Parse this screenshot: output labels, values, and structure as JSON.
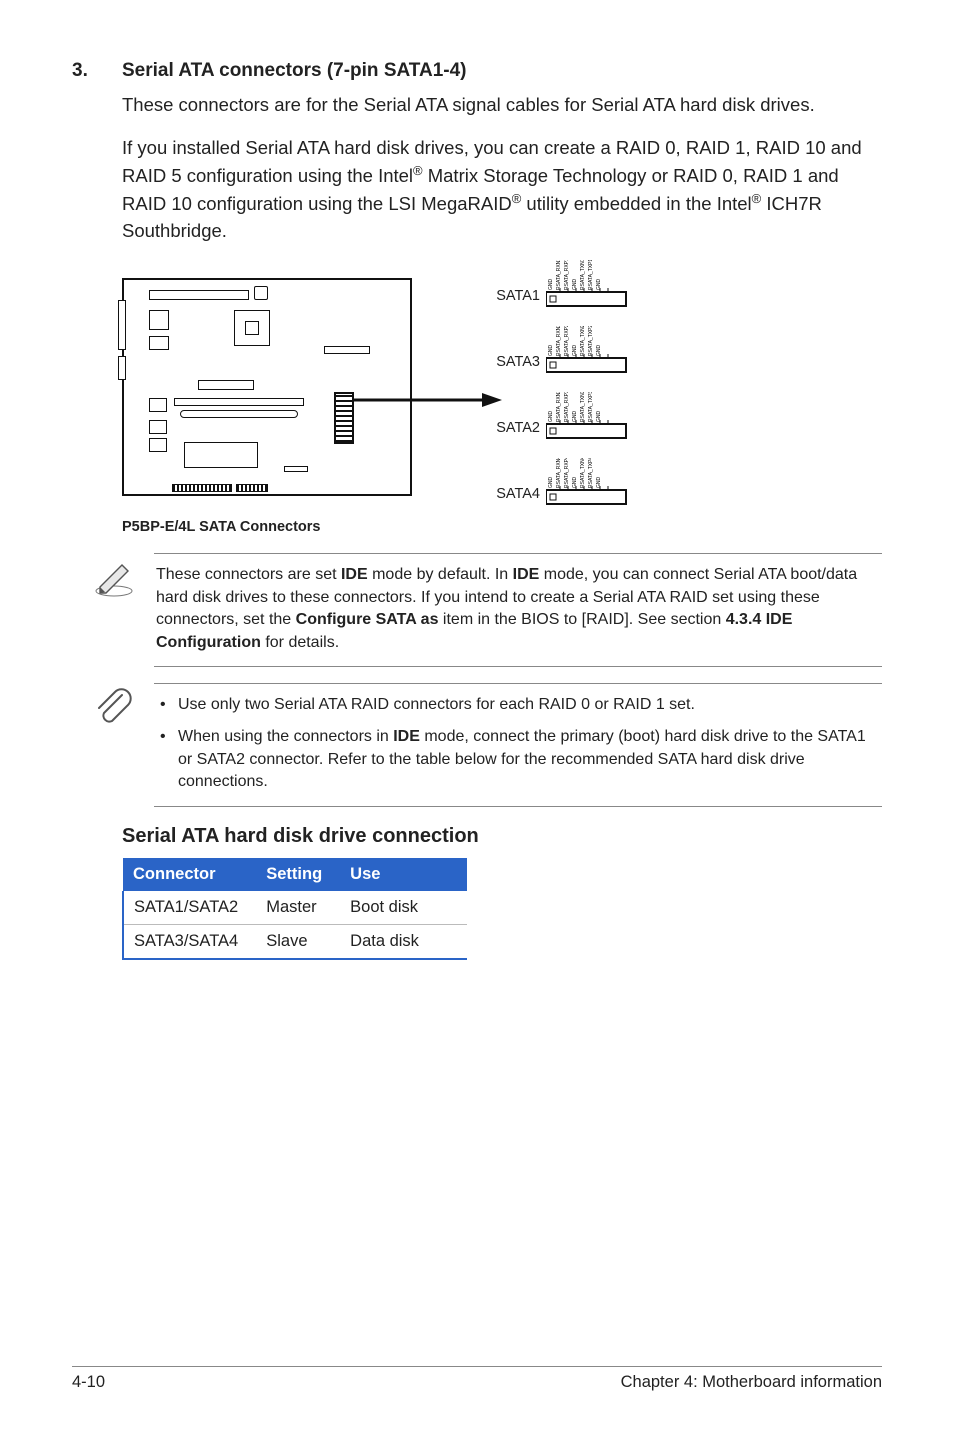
{
  "section": {
    "num": "3.",
    "title": "Serial ATA connectors (7-pin SATA1-4)"
  },
  "paras": {
    "p1": "These connectors are for the Serial ATA signal cables for Serial ATA hard disk drives.",
    "p2a": "If you installed Serial ATA hard disk drives, you can create a RAID 0, RAID 1, RAID 10 and RAID 5 configuration using the Intel",
    "p2b": " Matrix Storage Technology or RAID 0, RAID 1 and RAID 10 configuration using the LSI MegaRAID",
    "p2c": " utility embedded in the Intel",
    "p2d": " ICH7R Southbridge."
  },
  "diagram": {
    "caption": "P5BP-E/4L SATA Connectors",
    "conns": [
      "SATA1",
      "SATA3",
      "SATA2",
      "SATA4"
    ],
    "pins_a": [
      "GND",
      "RSATA_RXN1",
      "RSATA_RXP1",
      "GND",
      "RSATA_TXN1",
      "RSATA_TXP1",
      "GND"
    ],
    "pins_b": [
      "GND",
      "RSATA_RXN2",
      "RSATA_RXP2",
      "GND",
      "RSATA_TXN2",
      "RSATA_TXP2",
      "GND"
    ],
    "pins_c": [
      "GND",
      "RSATA_RXN3",
      "RSATA_RXP3",
      "GND",
      "RSATA_TXN3",
      "RSATA_TXP3",
      "GND"
    ],
    "pins_d": [
      "GND",
      "RSATA_RXN4",
      "RSATA_RXP4",
      "GND",
      "RSATA_TXN4",
      "RSATA_TXP4",
      "GND"
    ]
  },
  "pencil_note": {
    "t1": "These connectors are set ",
    "b1": "IDE",
    "t2": " mode by default. In ",
    "b2": "IDE",
    "t3": " mode, you can connect Serial ATA boot/data hard disk drives to these connectors. If you intend to create a Serial ATA RAID set using these connectors, set the ",
    "b3": "Configure SATA as",
    "t4": " item in the BIOS to [RAID]. See section ",
    "b4": "4.3.4 IDE Configuration",
    "t5": " for details."
  },
  "clip_note": {
    "li1": "Use only two Serial ATA RAID connectors for each RAID 0 or RAID 1 set.",
    "li2a": "When using the connectors in ",
    "li2b": "IDE",
    "li2c": " mode, connect the primary (boot) hard disk drive to the SATA1 or SATA2 connector. Refer to the table below for the recommended SATA hard disk drive connections."
  },
  "table": {
    "title": "Serial ATA hard disk drive connection",
    "head": {
      "c1": "Connector",
      "c2": "Setting",
      "c3": "Use"
    },
    "rows": [
      {
        "c1": "SATA1/SATA2",
        "c2": "Master",
        "c3": "Boot disk"
      },
      {
        "c1": "SATA3/SATA4",
        "c2": "Slave",
        "c3": "Data disk"
      }
    ]
  },
  "footer": {
    "left": "4-10",
    "right": "Chapter 4:  Motherboard information"
  }
}
